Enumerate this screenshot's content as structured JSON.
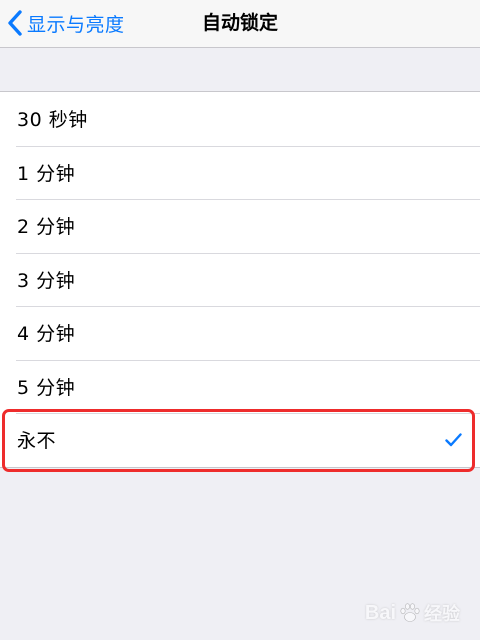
{
  "header": {
    "back_label": "显示与亮度",
    "title": "自动锁定"
  },
  "options": [
    {
      "label": "30 秒钟",
      "selected": false
    },
    {
      "label": "1 分钟",
      "selected": false
    },
    {
      "label": "2 分钟",
      "selected": false
    },
    {
      "label": "3 分钟",
      "selected": false
    },
    {
      "label": "4 分钟",
      "selected": false
    },
    {
      "label": "5 分钟",
      "selected": false
    },
    {
      "label": "永不",
      "selected": true
    }
  ],
  "watermark": {
    "brand": "Bai",
    "suffix": "经验"
  },
  "icons": {
    "back": "chevron-left-icon",
    "selected": "checkmark-icon",
    "watermark": "paw-icon"
  },
  "colors": {
    "accent": "#0a7aff",
    "highlight": "#ee2c2c",
    "background": "#efeff4"
  }
}
